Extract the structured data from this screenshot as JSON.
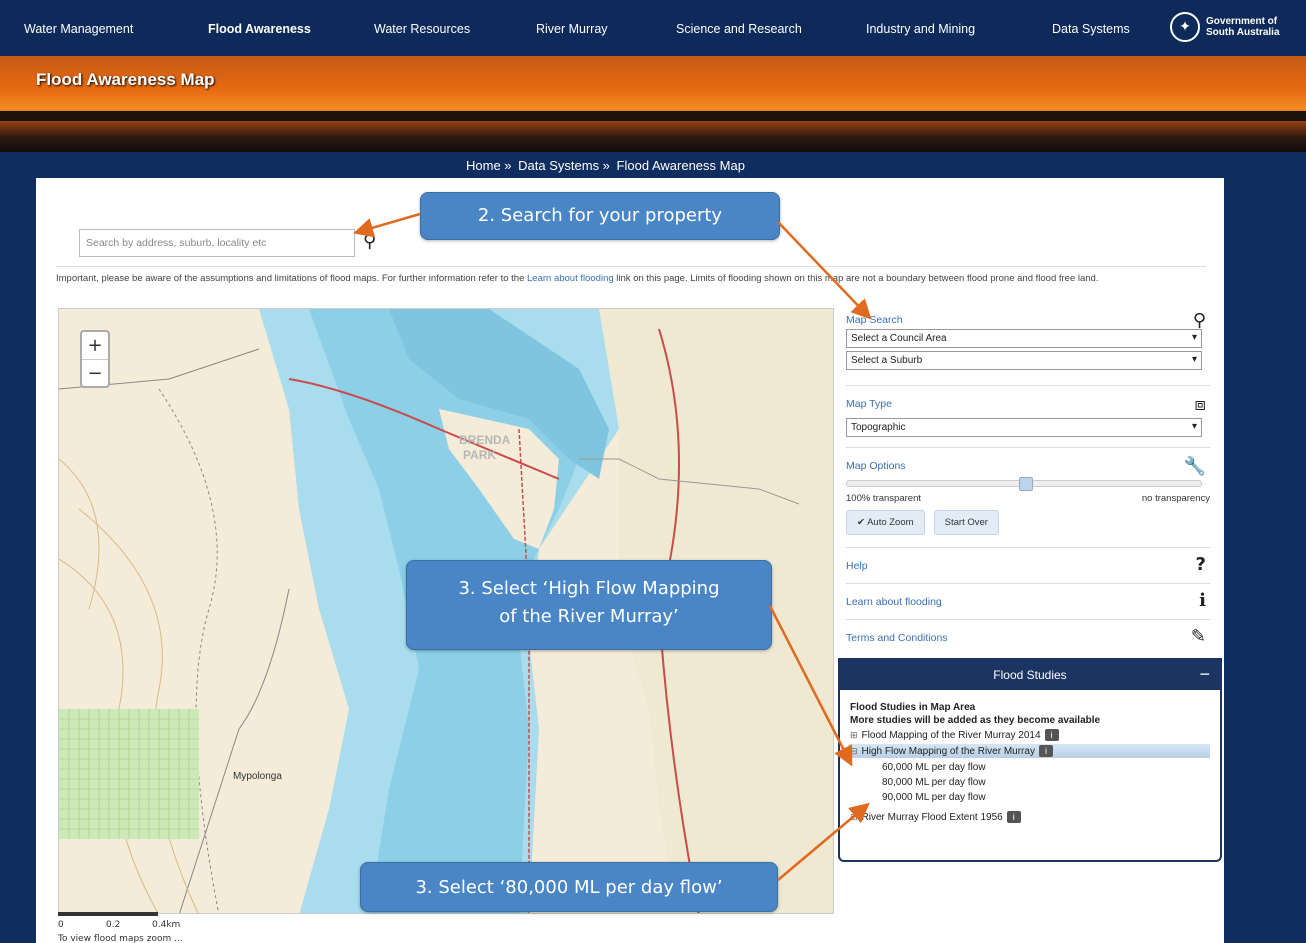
{
  "nav": {
    "items": [
      "Water Management",
      "Flood Awareness",
      "Water Resources",
      "River Murray",
      "Science and Research",
      "Industry and Mining",
      "Data Systems"
    ],
    "active": "Flood Awareness",
    "gov_line1": "Government of",
    "gov_line2": "South Australia"
  },
  "banner": {
    "title": "Flood Awareness Map"
  },
  "breadcrumb": {
    "home": "Home »",
    "data_systems": "Data Systems »",
    "current": "Flood Awareness Map"
  },
  "search": {
    "placeholder": "Search by address, suburb, locality etc"
  },
  "notice": {
    "before": "Important, please be aware of the assumptions and limitations of flood maps. For further information refer to the ",
    "link": "Learn about flooding",
    "after": " link on this page. Limits of flooding shown on this map are not a boundary between flood prone and flood free land."
  },
  "map": {
    "labels": {
      "park": "BRENDA",
      "park2": "PARK",
      "town": "Mypolonga"
    },
    "zoom_in": "+",
    "zoom_out": "−",
    "scale": [
      "0",
      "0.2",
      "0.4km"
    ]
  },
  "side": {
    "map_search": {
      "title": "Map Search",
      "council_select": "Select a Council Area",
      "suburb_select": "Select a Suburb"
    },
    "map_type": {
      "title": "Map Type",
      "value": "Topographic"
    },
    "map_options": {
      "title": "Map Options",
      "left_label": "100% transparent",
      "right_label": "no transparency",
      "auto_zoom": "✔ Auto Zoom",
      "start_over": "Start Over"
    },
    "help": "Help",
    "learn": "Learn about flooding",
    "terms": "Terms and Conditions"
  },
  "flood": {
    "header": "Flood Studies",
    "line1": "Flood Studies in Map Area",
    "line2": "More studies will be added as they become available",
    "study1": "Flood Mapping of the River Murray 2014",
    "study2": "High Flow Mapping of the River Murray",
    "flows": [
      "60,000 ML per day flow",
      "80,000 ML per day flow",
      "90,000 ML per day flow"
    ],
    "study3": "River Murray Flood Extent 1956"
  },
  "callouts": {
    "search": "2. Search for your property",
    "high_flow_1": "3. Select ‘High Flow Mapping",
    "high_flow_2": "of the River Murray’",
    "flow": "3. Select ‘80,000 ML per day flow’"
  },
  "footer": "To view flood maps zoom ..."
}
